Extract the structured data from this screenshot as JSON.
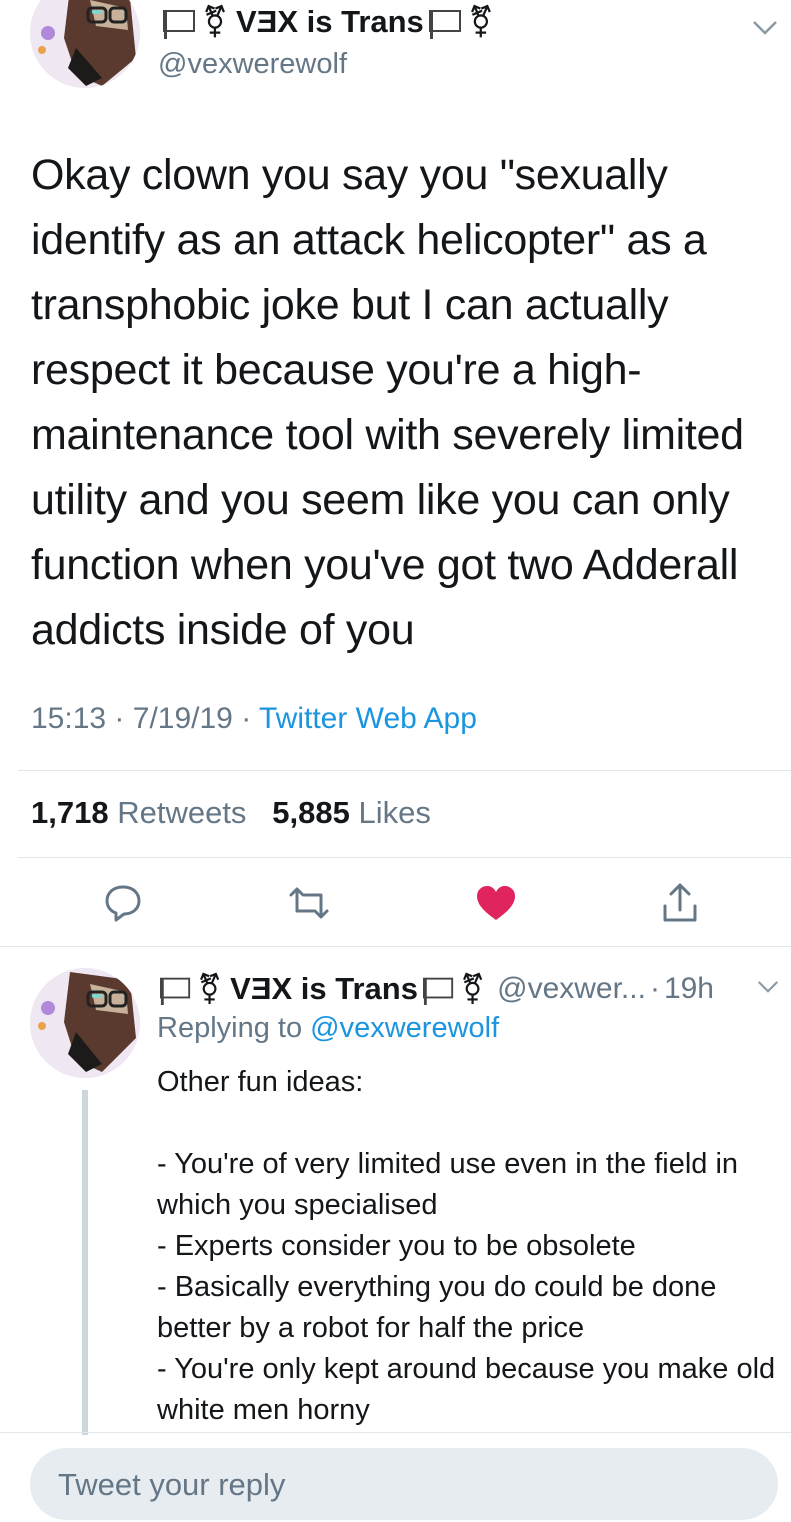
{
  "tweet": {
    "author": {
      "display_name": "VƎX is Trans",
      "handle": "@vexwerewolf",
      "name_symbol": "⚧",
      "avatar_icon": "werewolf-avatar-icon",
      "flag_icon": "white-flag-icon"
    },
    "text": "Okay clown you say you \"sexually identify as an attack helicopter\" as a transphobic joke but I can actually respect it because you're a high-maintenance tool with severely limited utility and you seem like you can only function when you've got two Adderall addicts inside of you",
    "time": "15:13",
    "date": "7/19/19",
    "separator": "·",
    "source": "Twitter Web App",
    "retweet_count": "1,718",
    "retweet_label": "Retweets",
    "like_count": "5,885",
    "like_label": "Likes",
    "actions": {
      "reply_icon": "reply-icon",
      "retweet_icon": "retweet-icon",
      "like_icon": "heart-icon",
      "share_icon": "share-icon"
    }
  },
  "reply": {
    "author": {
      "display_name": "VƎX is Trans",
      "handle_truncated": "@vexwer...",
      "name_symbol": "⚧"
    },
    "separator": "·",
    "age": "19h",
    "replying_to_label": "Replying to",
    "replying_to_handle": "@vexwerewolf",
    "text": "Other fun ideas:\n\n- You're of very limited use even in the field in which you specialised\n- Experts consider you to be obsolete\n- Basically everything you do could be done better by a robot for half the price\n- You're only kept around because you make old white men horny"
  },
  "composer": {
    "placeholder": "Tweet your reply"
  },
  "colors": {
    "text": "#14171a",
    "secondary": "#657786",
    "link": "#1b95e0",
    "like": "#e0245e",
    "divider": "#e1e8ed",
    "composer_bg": "#e6ecf0"
  }
}
